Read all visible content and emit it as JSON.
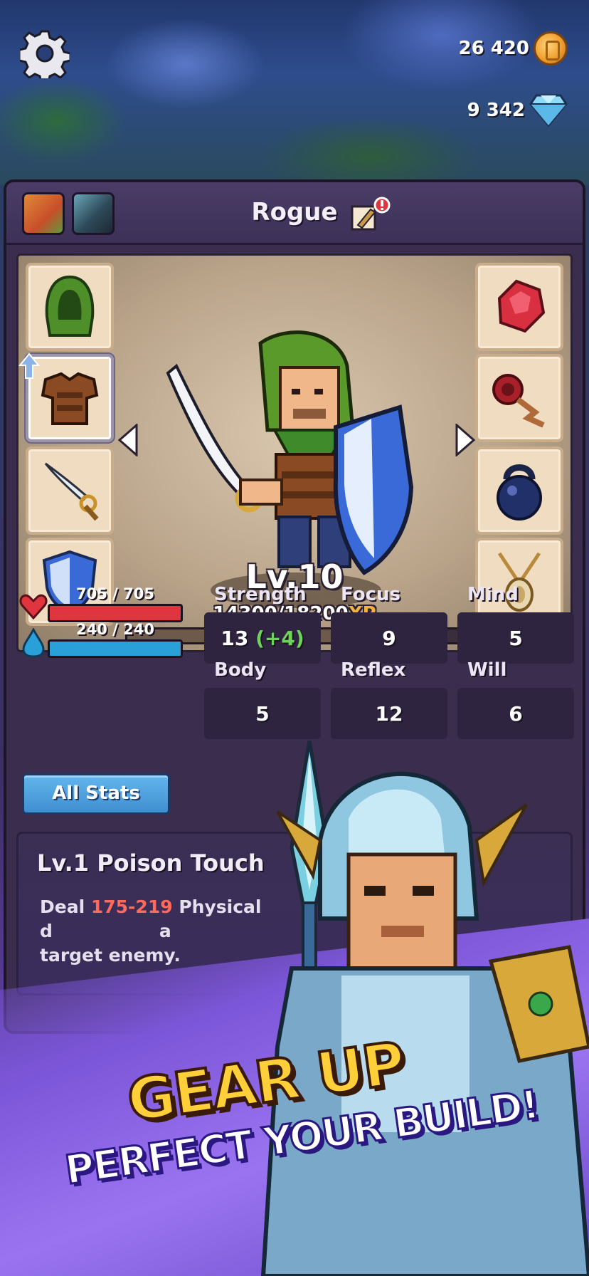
{
  "currency": {
    "coins": "26 420",
    "gems": "9 342"
  },
  "panel": {
    "class_name": "Rogue"
  },
  "hero": {
    "level": "Lv.10",
    "xp_text": "14300/18200",
    "xp_unit": "XP",
    "xp_fraction": 0.786
  },
  "vitals": {
    "hp": "705 / 705",
    "mp": "240 / 240"
  },
  "stats": [
    {
      "label": "Strength",
      "value": "13",
      "bonus": "(+4)"
    },
    {
      "label": "Focus",
      "value": "9",
      "bonus": ""
    },
    {
      "label": "Mind",
      "value": "5",
      "bonus": ""
    },
    {
      "label": "Body",
      "value": "5",
      "bonus": ""
    },
    {
      "label": "Reflex",
      "value": "12",
      "bonus": ""
    },
    {
      "label": "Will",
      "value": "6",
      "bonus": ""
    }
  ],
  "all_stats_label": "All Stats",
  "skill": {
    "title": "Lv.1 Poison Touch",
    "desc_prefix": "Deal",
    "damage": "175-219",
    "desc_mid": "Physical d",
    "desc_end": "a",
    "desc_line2": "target enemy."
  },
  "promo": {
    "line1": "GEAR UP",
    "line2": "PERFECT YOUR BUILD!"
  },
  "colors": {
    "hp": "#e0353e",
    "mp": "#2aa0d8",
    "bonus": "#6fd35a",
    "damage": "#ff6a5a",
    "headline_gold": "#ffcf3a"
  }
}
